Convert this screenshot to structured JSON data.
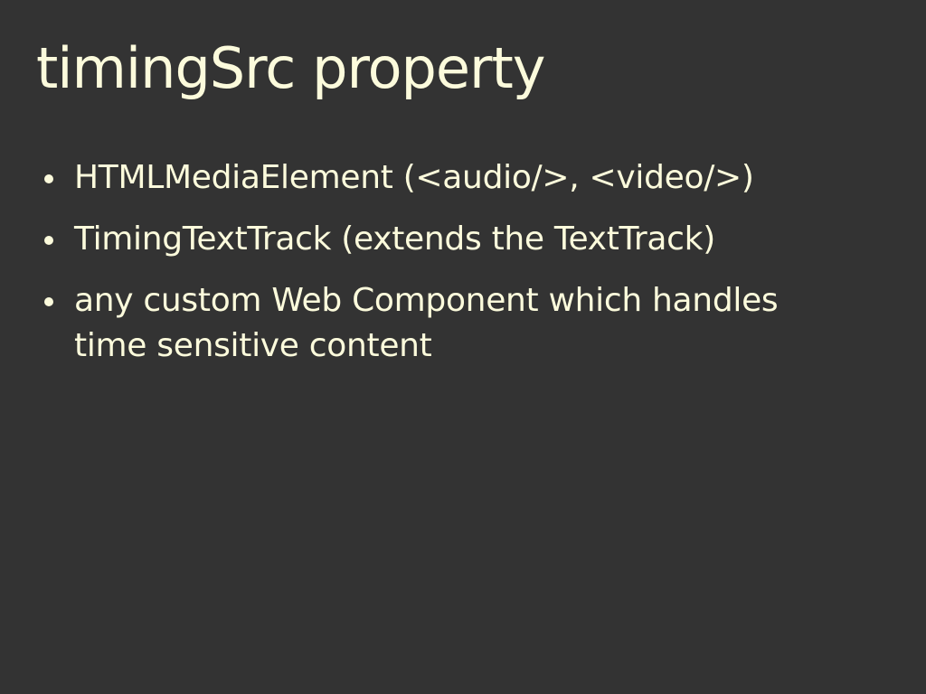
{
  "slide": {
    "title": "timingSrc property",
    "bullets": [
      {
        "text": "HTMLMediaElement (<audio/>, <video/>)"
      },
      {
        "text": "TimingTextTrack (extends the TextTrack)"
      },
      {
        "text": "any custom Web Component which handles time sensitive content"
      }
    ]
  },
  "colors": {
    "background": "#333333",
    "text": "#fcfbdc"
  }
}
